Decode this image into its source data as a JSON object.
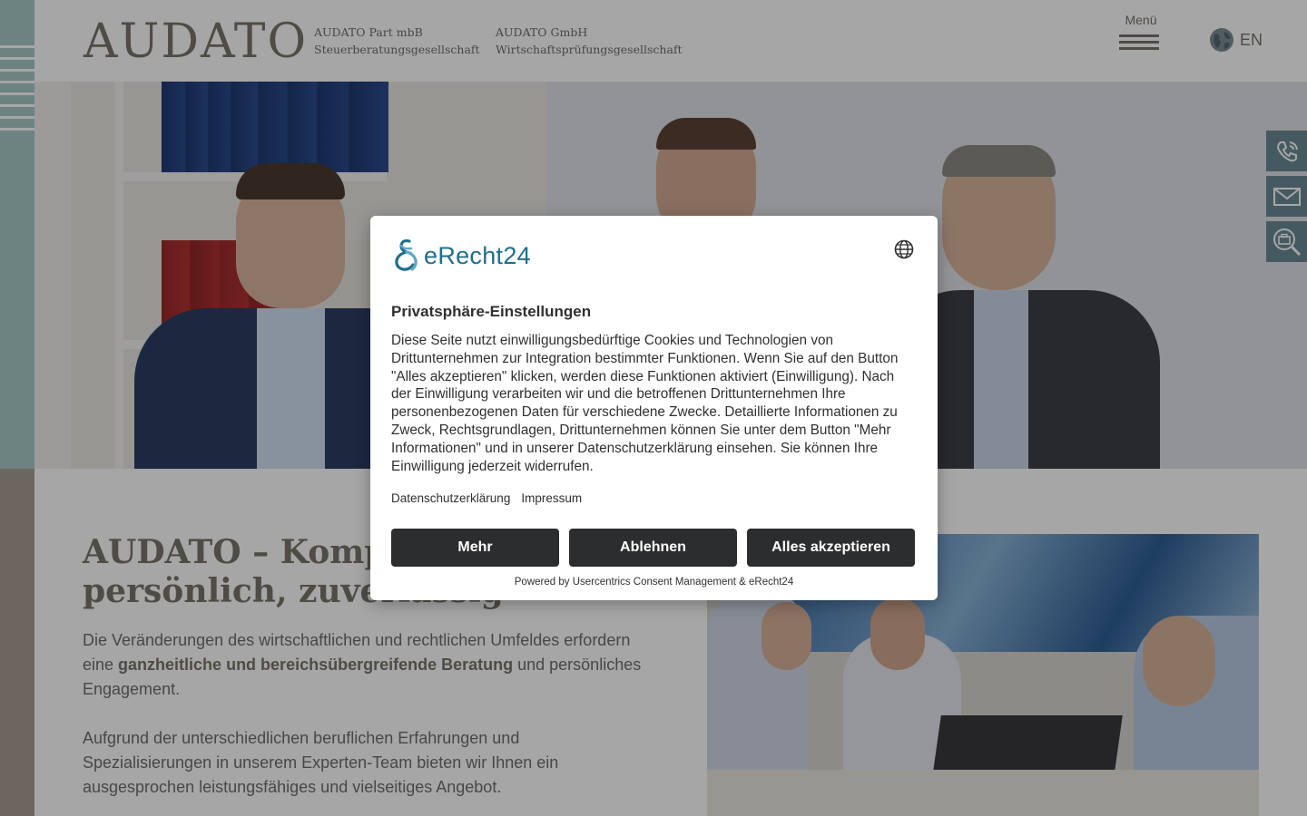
{
  "header": {
    "logo": "AUDATO",
    "companies": [
      {
        "line1": "AUDATO Part mbB",
        "line2": "Steuerberatungsgesellschaft"
      },
      {
        "line1": "AUDATO GmbH",
        "line2": "Wirtschaftsprüfungsgesellschaft"
      }
    ],
    "menu_label": "Menü",
    "language_label": "EN"
  },
  "side_actions": {
    "phone_icon": "phone-icon",
    "mail_icon": "mail-icon",
    "jobs_icon": "briefcase-search-icon"
  },
  "content": {
    "title": "AUDATO – Kompetent, persönlich, zuverlässig",
    "para1_before": "Die Veränderungen des wirtschaftlichen und rechtlichen Umfeldes erfordern eine ",
    "para1_strong": "ganzheitliche und bereichsübergreifende Beratung",
    "para1_after": " und persönliches Engagement.",
    "para2": "Aufgrund der unterschiedlichen beruflichen Erfahrungen und Spezialisierungen in unserem Experten-Team bieten wir Ihnen ein ausgesprochen leistungsfähiges und vielseitiges Angebot."
  },
  "consent": {
    "brand": "eRecht24",
    "title": "Privatsphäre-Einstellungen",
    "body": "Diese Seite nutzt einwilligungsbedürftige Cookies und Technologien von Drittunternehmen zur Integration bestimmter Funktionen. Wenn Sie auf den Button \"Alles akzeptieren\" klicken, werden diese Funktionen aktiviert (Einwilligung). Nach der Einwilligung verarbeiten wir und die betroffenen Drittunternehmen Ihre personenbezogenen Daten für verschiedene Zwecke. Detaillierte Informationen zu Zweck, Rechtsgrundlagen, Drittunternehmen können Sie unter dem Button \"Mehr Informationen\" und in unserer Datenschutzerklärung einsehen. Sie können Ihre Einwilligung jederzeit widerrufen.",
    "link_privacy": "Datenschutzerklärung",
    "link_imprint": "Impressum",
    "btn_more": "Mehr",
    "btn_decline": "Ablehnen",
    "btn_accept": "Alles akzeptieren",
    "powered_by": "Powered by Usercentrics Consent Management & eRecht24"
  },
  "colors": {
    "accent_teal": "#a8c9c6",
    "accent_taupe": "#a79d92",
    "button_dark": "#2c2d2f",
    "brand_blue": "#1f6e8c"
  }
}
